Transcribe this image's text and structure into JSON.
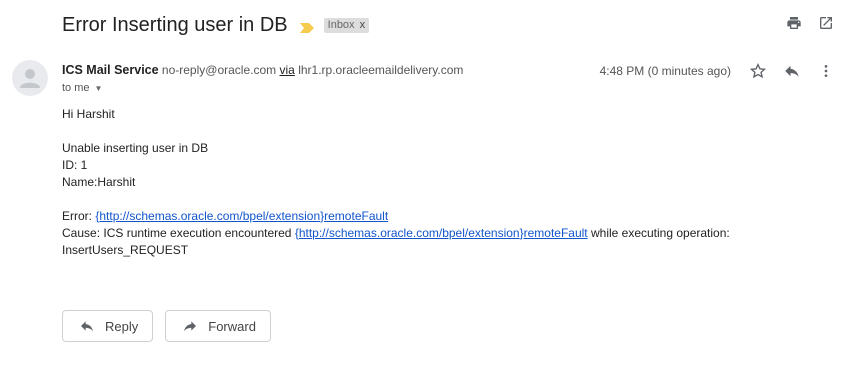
{
  "subject": "Error Inserting user in DB",
  "label": {
    "name": "Inbox",
    "remove_glyph": "x"
  },
  "importance_color": "#f7cb4d",
  "top_actions": {
    "print_icon": "print-icon",
    "open_new_window_icon": "open-in-new-icon"
  },
  "sender": {
    "name": "ICS Mail Service",
    "email": "no-reply@oracle.com",
    "via_label": "via",
    "via_domain": "lhr1.rp.oracleemaildelivery.com"
  },
  "recipient": {
    "label": "to me"
  },
  "timestamp": "4:48 PM (0 minutes ago)",
  "message_actions": [
    "star-icon",
    "reply-icon",
    "more-vert-icon"
  ],
  "body": {
    "greeting": "Hi Harshit",
    "line1": "Unable inserting user in DB",
    "line2": "ID: 1",
    "line3": "Name:Harshit",
    "error_prefix": "Error: ",
    "error_link": "{http://schemas.oracle.com/bpel/extension}remoteFault",
    "cause_prefix": "Cause: ICS runtime execution encountered ",
    "cause_link": "{http://schemas.oracle.com/bpel/extension}remoteFault",
    "cause_suffix": " while executing operation:",
    "operation": "InsertUsers_REQUEST"
  },
  "buttons": {
    "reply": "Reply",
    "forward": "Forward"
  },
  "colors": {
    "link": "#1155cc",
    "label_bg": "#dddddd"
  }
}
